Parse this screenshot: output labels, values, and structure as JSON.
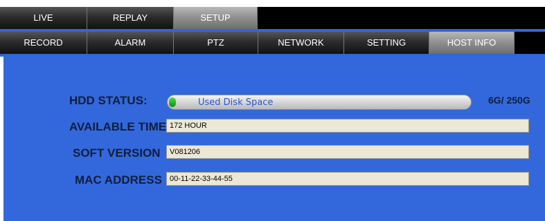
{
  "tabs_top": [
    {
      "label": "LIVE",
      "active": false
    },
    {
      "label": "REPLAY",
      "active": false
    },
    {
      "label": "SETUP",
      "active": true
    }
  ],
  "tabs_setup": [
    {
      "label": "RECORD",
      "active": false
    },
    {
      "label": "ALARM",
      "active": false
    },
    {
      "label": "PTZ",
      "active": false
    },
    {
      "label": "NETWORK",
      "active": false
    },
    {
      "label": "SETTING",
      "active": false
    },
    {
      "label": "HOST INFO",
      "active": true
    }
  ],
  "host_info": {
    "hdd_status_label": "HDD STATUS:",
    "disk_bar_text": "Used Disk Space",
    "disk_used_fraction": 0.024,
    "disk_usage_text": "6G/ 250G",
    "available_time_label": "AVAILABLE TIME",
    "available_time_value": "172 HOUR",
    "soft_version_label": "SOFT VERSION",
    "soft_version_value": "V081206",
    "mac_address_label": "MAC ADDRESS",
    "mac_address_value": "00-11-22-33-44-55"
  },
  "colors": {
    "panel_bg": "#3368dd",
    "tab_active": "#8e8e8e",
    "tab_inactive": "#2c2c2c",
    "field_bg": "#ede8d6",
    "bar_fill": "#1aa81a"
  }
}
